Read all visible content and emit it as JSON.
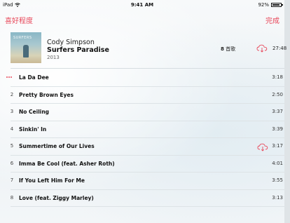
{
  "status_bar": {
    "device": "iPad",
    "time": "9:41 AM",
    "battery": "92%",
    "battery_level": 0.92
  },
  "nav": {
    "left_label": "喜好程度",
    "right_label": "完成"
  },
  "album": {
    "artist": "Cody Simpson",
    "title": "Surfers Paradise",
    "year": "2013",
    "song_count_number": "8",
    "song_count_unit": "首歌",
    "total_duration": "27:48"
  },
  "tracks": [
    {
      "number": "",
      "title": "La Da Dee",
      "duration": "3:18",
      "now_playing": true,
      "cloud": false
    },
    {
      "number": "2",
      "title": "Pretty Brown Eyes",
      "duration": "2:50",
      "cloud": false
    },
    {
      "number": "3",
      "title": "No Ceiling",
      "duration": "3:37",
      "cloud": false
    },
    {
      "number": "4",
      "title": "Sinkin' In",
      "duration": "3:39",
      "cloud": false
    },
    {
      "number": "5",
      "title": "Summertime of Our Lives",
      "duration": "3:17",
      "cloud": true
    },
    {
      "number": "6",
      "title": "Imma Be Cool (feat. Asher Roth)",
      "duration": "4:01",
      "cloud": false
    },
    {
      "number": "7",
      "title": "If You Left Him For Me",
      "duration": "3:55",
      "cloud": false
    },
    {
      "number": "8",
      "title": "Love (feat. Ziggy Marley)",
      "duration": "3:13",
      "cloud": false
    }
  ],
  "colors": {
    "accent": "#e8475a"
  }
}
